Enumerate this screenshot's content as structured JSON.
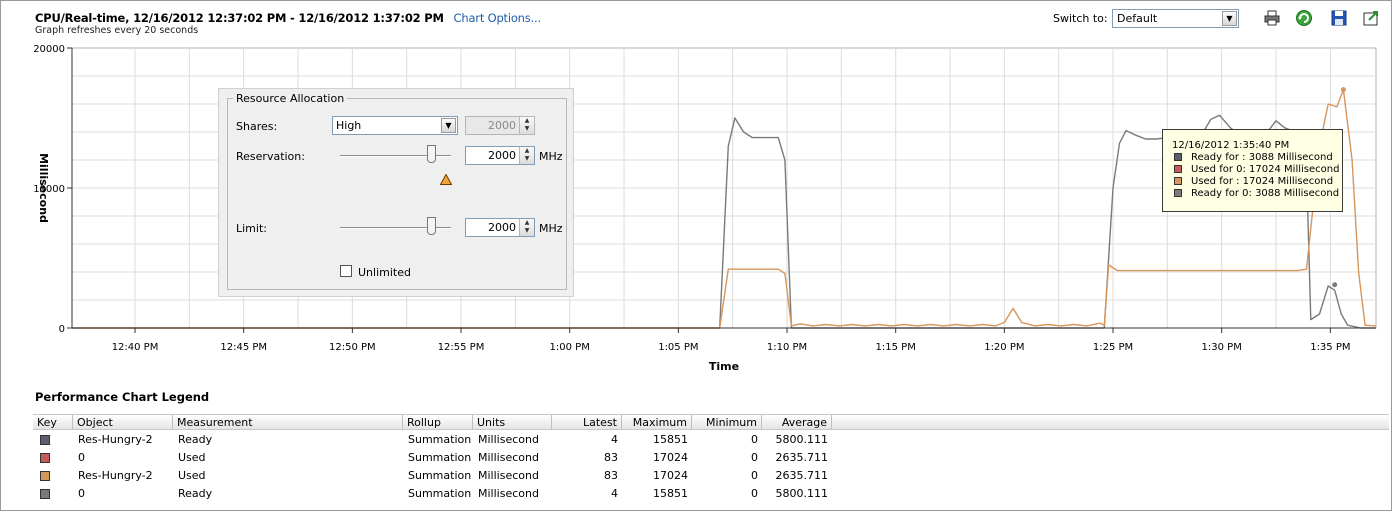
{
  "header": {
    "title": "CPU/Real-time, 12/16/2012 12:37:02 PM - 12/16/2012 1:37:02 PM",
    "chart_options": "Chart Options...",
    "subtitle": "Graph refreshes every 20 seconds",
    "switch_label": "Switch to:",
    "switch_value": "Default"
  },
  "toolbar": {
    "icons": [
      "print-icon",
      "refresh-icon",
      "save-icon",
      "export-icon"
    ]
  },
  "chart_data": {
    "type": "line",
    "ylabel": "Millisecond",
    "xlabel": "Time",
    "ylim": [
      0,
      20000
    ],
    "yticks": [
      "20000",
      "10000",
      "0"
    ],
    "x_ticks": [
      "12:40 PM",
      "12:45 PM",
      "12:50 PM",
      "12:55 PM",
      "1:00 PM",
      "1:05 PM",
      "1:10 PM",
      "1:15 PM",
      "1:20 PM",
      "1:25 PM",
      "1:30 PM",
      "1:35 PM"
    ],
    "x_tick_minutes": [
      40,
      45,
      50,
      55,
      60,
      65,
      70,
      75,
      80,
      85,
      90,
      95
    ],
    "xlim_minutes": [
      37.1,
      97.1
    ],
    "grid": true,
    "series": [
      {
        "name": "Ready",
        "color": "#7a7a7a",
        "points": [
          [
            37.1,
            0
          ],
          [
            66.9,
            0
          ],
          [
            67.3,
            13000
          ],
          [
            67.6,
            15000
          ],
          [
            68.0,
            14000
          ],
          [
            68.4,
            13600
          ],
          [
            69.0,
            13600
          ],
          [
            69.6,
            13600
          ],
          [
            69.9,
            12000
          ],
          [
            70.2,
            0
          ],
          [
            84.6,
            0
          ],
          [
            85.0,
            10000
          ],
          [
            85.3,
            13200
          ],
          [
            85.6,
            14100
          ],
          [
            86.0,
            13800
          ],
          [
            86.5,
            13500
          ],
          [
            87.0,
            13500
          ],
          [
            87.5,
            13600
          ],
          [
            88.0,
            13400
          ],
          [
            88.5,
            13800
          ],
          [
            89.0,
            13600
          ],
          [
            89.5,
            14900
          ],
          [
            89.9,
            15200
          ],
          [
            90.4,
            14300
          ],
          [
            91.0,
            13600
          ],
          [
            91.6,
            13600
          ],
          [
            92.0,
            13800
          ],
          [
            92.5,
            14800
          ],
          [
            92.9,
            14300
          ],
          [
            93.4,
            14000
          ],
          [
            93.9,
            11500
          ],
          [
            94.1,
            600
          ],
          [
            94.5,
            1000
          ],
          [
            94.9,
            3000
          ],
          [
            95.2,
            2700
          ],
          [
            95.5,
            1000
          ],
          [
            95.8,
            200
          ],
          [
            96.4,
            0
          ],
          [
            97.1,
            0
          ]
        ]
      },
      {
        "name": "Used",
        "color": "#d7965a",
        "points": [
          [
            37.1,
            0
          ],
          [
            66.9,
            0
          ],
          [
            67.3,
            4200
          ],
          [
            67.8,
            4200
          ],
          [
            68.4,
            4200
          ],
          [
            69.0,
            4200
          ],
          [
            69.6,
            4200
          ],
          [
            69.9,
            3900
          ],
          [
            70.2,
            150
          ],
          [
            70.6,
            300
          ],
          [
            71.2,
            150
          ],
          [
            71.8,
            250
          ],
          [
            72.4,
            150
          ],
          [
            73.0,
            250
          ],
          [
            73.6,
            150
          ],
          [
            74.2,
            250
          ],
          [
            74.8,
            150
          ],
          [
            75.4,
            250
          ],
          [
            76.0,
            150
          ],
          [
            76.6,
            250
          ],
          [
            77.2,
            150
          ],
          [
            77.8,
            250
          ],
          [
            78.4,
            150
          ],
          [
            79.0,
            250
          ],
          [
            79.6,
            150
          ],
          [
            80.0,
            400
          ],
          [
            80.4,
            1400
          ],
          [
            80.8,
            400
          ],
          [
            81.4,
            150
          ],
          [
            82.0,
            250
          ],
          [
            82.6,
            150
          ],
          [
            83.2,
            250
          ],
          [
            83.8,
            150
          ],
          [
            84.4,
            350
          ],
          [
            84.6,
            200
          ],
          [
            84.8,
            4500
          ],
          [
            85.2,
            4100
          ],
          [
            85.8,
            4100
          ],
          [
            86.5,
            4100
          ],
          [
            87.5,
            4100
          ],
          [
            88.5,
            4100
          ],
          [
            89.5,
            4100
          ],
          [
            90.5,
            4100
          ],
          [
            91.5,
            4100
          ],
          [
            92.5,
            4100
          ],
          [
            93.5,
            4100
          ],
          [
            93.9,
            4200
          ],
          [
            94.5,
            13000
          ],
          [
            94.9,
            16000
          ],
          [
            95.3,
            15800
          ],
          [
            95.6,
            17024
          ],
          [
            96.0,
            12000
          ],
          [
            96.3,
            4000
          ],
          [
            96.6,
            200
          ],
          [
            97.1,
            150
          ]
        ]
      }
    ]
  },
  "resource_allocation": {
    "title": "Resource Allocation",
    "shares_label": "Shares:",
    "shares_value": "High",
    "shares_number": "2000",
    "reservation_label": "Reservation:",
    "reservation_value": "2000",
    "reservation_unit": "MHz",
    "limit_label": "Limit:",
    "limit_value": "2000",
    "limit_unit": "MHz",
    "unlimited_label": "Unlimited"
  },
  "tooltip": {
    "time": "12/16/2012 1:35:40 PM",
    "rows": [
      {
        "text": "Ready for : 3088 Millisecond",
        "color": "#5a5f6e"
      },
      {
        "text": "Used for 0: 17024 Millisecond",
        "color": "#c65a5a"
      },
      {
        "text": "Used for : 17024 Millisecond",
        "color": "#d7965a"
      },
      {
        "text": "Ready for 0: 3088 Millisecond",
        "color": "#7a7a7a"
      }
    ]
  },
  "legend": {
    "title": "Performance Chart Legend",
    "columns": [
      "Key",
      "Object",
      "Measurement",
      "Rollup",
      "Units",
      "Latest",
      "Maximum",
      "Minimum",
      "Average"
    ],
    "rows": [
      {
        "color": "#5a5f6e",
        "object": "Res-Hungry-2",
        "measurement": "Ready",
        "rollup": "Summation",
        "units": "Millisecond",
        "latest": "4",
        "maximum": "15851",
        "minimum": "0",
        "average": "5800.111"
      },
      {
        "color": "#c65a5a",
        "object": "0",
        "measurement": "Used",
        "rollup": "Summation",
        "units": "Millisecond",
        "latest": "83",
        "maximum": "17024",
        "minimum": "0",
        "average": "2635.711"
      },
      {
        "color": "#d7965a",
        "object": "Res-Hungry-2",
        "measurement": "Used",
        "rollup": "Summation",
        "units": "Millisecond",
        "latest": "83",
        "maximum": "17024",
        "minimum": "0",
        "average": "2635.711"
      },
      {
        "color": "#7a7a7a",
        "object": "0",
        "measurement": "Ready",
        "rollup": "Summation",
        "units": "Millisecond",
        "latest": "4",
        "maximum": "15851",
        "minimum": "0",
        "average": "5800.111"
      }
    ]
  }
}
